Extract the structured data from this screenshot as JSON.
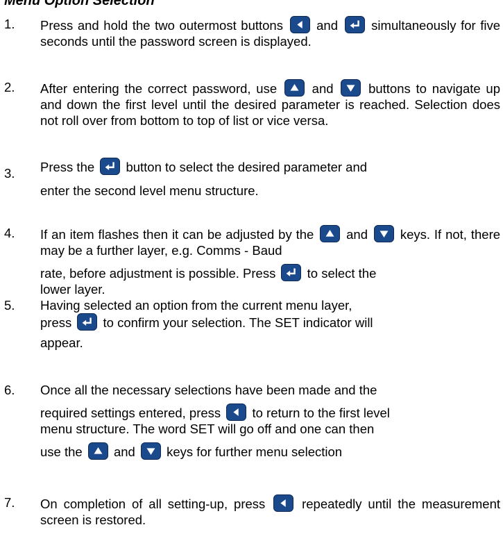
{
  "heading": "Menu Option Selection",
  "items": [
    {
      "num": "1.",
      "t1": "Press and hold the two outermost buttons",
      "t2": "and",
      "t3": "simultaneously for five seconds until the password screen is displayed."
    },
    {
      "num": "2.",
      "t1": "After entering the correct password, use",
      "t2": "and",
      "t3": "buttons to navigate up and down the first level until the desired parameter is reached.  Selection does not roll over from bottom to top of list or vice versa."
    },
    {
      "num": "3.",
      "t1": "Press the",
      "t2": "button to select the desired parameter and",
      "t3": "enter the second level menu structure."
    },
    {
      "num": "4.",
      "t1": "If an item flashes then it can be adjusted by the",
      "t2": "and",
      "t3": "keys.  If not, there may be a further layer, e.g. Comms - Baud",
      "t4": "rate, before adjustment is possible.  Press",
      "t5": "to select the",
      "t6": "lower layer."
    },
    {
      "num": "5.",
      "t1": "Having selected an option from the current menu layer,",
      "t2": "press",
      "t3": "to confirm your selection.  The SET indicator will",
      "t4": "appear."
    },
    {
      "num": "6.",
      "t1": "Once all the necessary selections have been made and the",
      "t2": "required settings entered, press",
      "t3": "to return to the first level",
      "t4": "menu structure.  The word SET will go off and one can then",
      "t5": "use the",
      "t6": "and",
      "t7": "keys for further menu selection"
    },
    {
      "num": "7.",
      "t1": "On completion of all setting-up, press",
      "t2": "repeatedly until the",
      "t3": "measurement screen is restored."
    }
  ],
  "icons": {
    "left": "left-arrow-key-icon",
    "enter": "enter-key-icon",
    "up": "up-arrow-key-icon",
    "down": "down-arrow-key-icon"
  },
  "colors": {
    "key": "#1b4a8c",
    "glyph": "#ffffff"
  }
}
